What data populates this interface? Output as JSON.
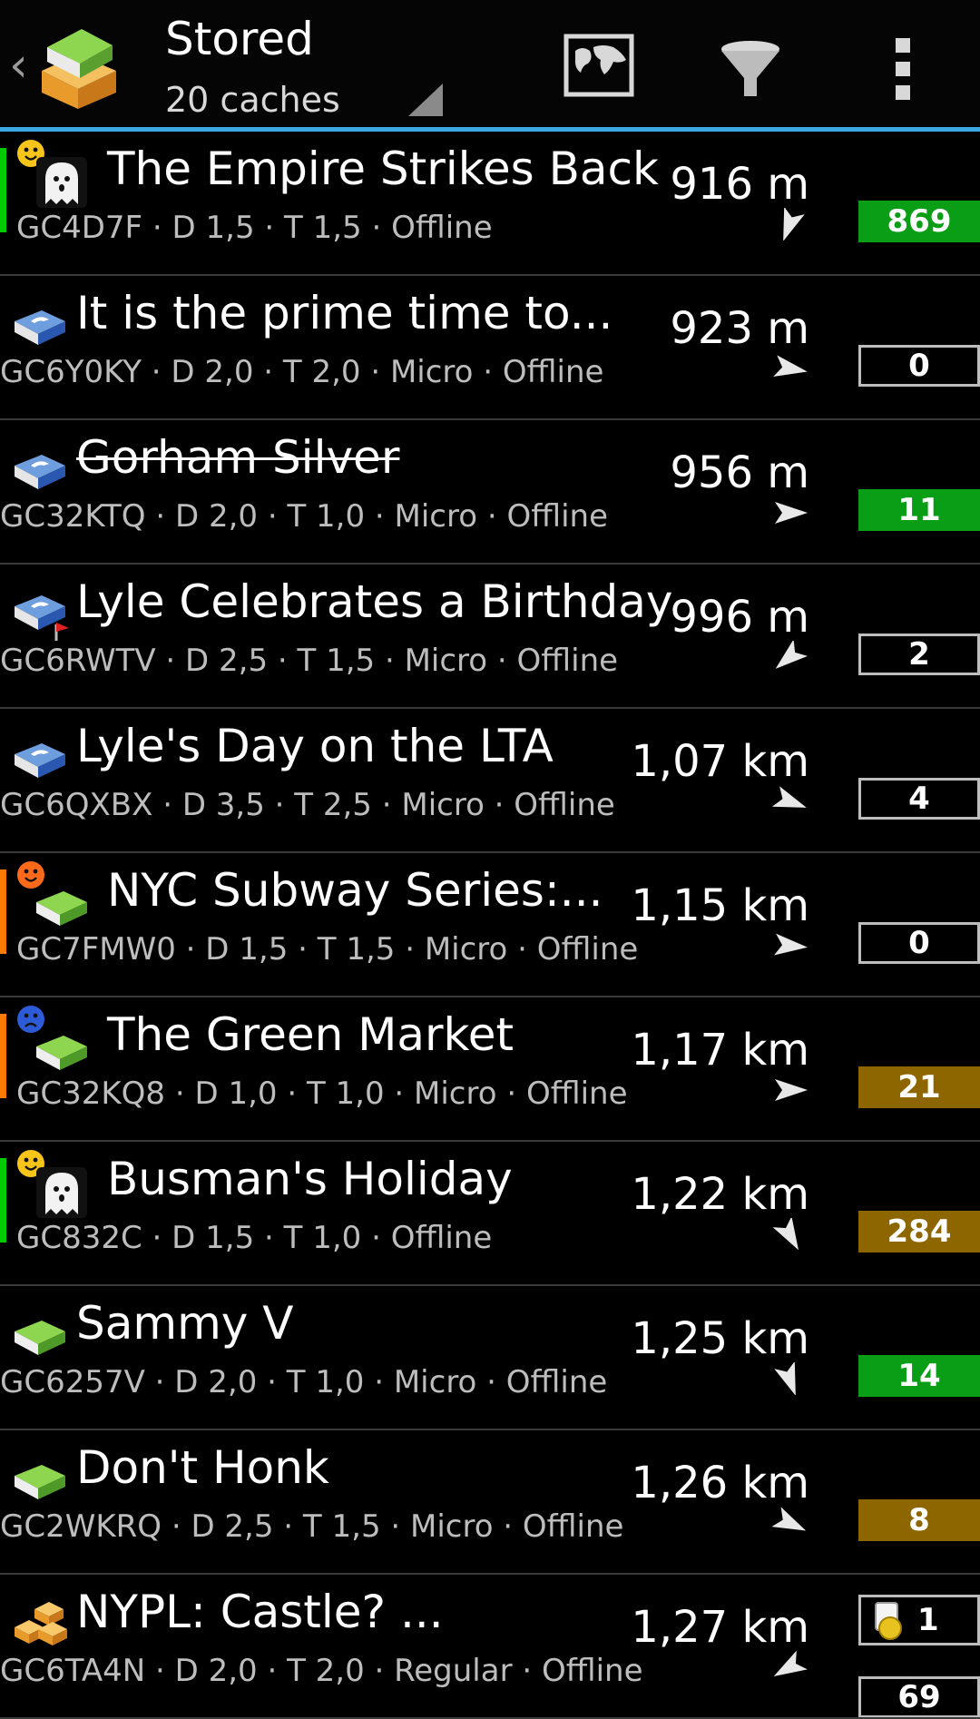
{
  "actionbar": {
    "title": "Stored",
    "subtitle": "20 caches",
    "back_icon": "chevron-left-icon",
    "app_icon": "cgeo-box-icon",
    "buttons": [
      {
        "name": "map-button",
        "icon": "world-map-icon"
      },
      {
        "name": "filter-button",
        "icon": "funnel-icon"
      },
      {
        "name": "overflow-menu-button",
        "icon": "more-vert-icon"
      }
    ],
    "accent": "#3aa7de"
  },
  "caches": [
    {
      "name": "The Empire Strikes Back",
      "info": "GC4D7F · D 1,5 · T 1,5 · Offline",
      "distance": "916 m",
      "count": "869",
      "count_style": "green",
      "type_icon": "ghost-icon",
      "face": "smiley-yellow",
      "stripe": "#00cc00",
      "struck": false,
      "bearing": 200
    },
    {
      "name": "It is the prime time to...",
      "info": "GC6Y0KY · D 2,0 · T 2,0 · Micro · Offline",
      "distance": "923 m",
      "count": "0",
      "count_style": "none",
      "type_icon": "mystery-box-icon",
      "face": "",
      "stripe": "",
      "struck": false,
      "bearing": 100
    },
    {
      "name": "Gorham Silver",
      "info": "GC32KTQ · D 2,0 · T 1,0 · Micro · Offline",
      "distance": "956 m",
      "count": "11",
      "count_style": "green",
      "type_icon": "mystery-box-icon",
      "face": "",
      "stripe": "",
      "struck": true,
      "bearing": 90
    },
    {
      "name": "Lyle Celebrates a Birthday",
      "info": "GC6RWTV · D 2,5 · T 1,5 · Micro · Offline",
      "distance": "996 m",
      "count": "2",
      "count_style": "none",
      "type_icon": "mystery-box-flag-icon",
      "face": "",
      "stripe": "",
      "struck": false,
      "bearing": 230
    },
    {
      "name": "Lyle's Day on the LTA",
      "info": "GC6QXBX · D 3,5 · T 2,5 · Micro · Offline",
      "distance": "1,07 km",
      "count": "4",
      "count_style": "none",
      "type_icon": "mystery-box-icon",
      "face": "",
      "stripe": "",
      "struck": false,
      "bearing": 110
    },
    {
      "name": "NYC Subway Series:...",
      "info": "GC7FMW0 · D 1,5 · T 1,5 · Micro · Offline",
      "distance": "1,15 km",
      "count": "0",
      "count_style": "none",
      "type_icon": "traditional-box-icon",
      "face": "smiley-orange",
      "stripe": "#ff7a00",
      "struck": false,
      "bearing": 95
    },
    {
      "name": "The Green Market",
      "info": "GC32KQ8 · D 1,0 · T 1,0 · Micro · Offline",
      "distance": "1,17 km",
      "count": "21",
      "count_style": "gold",
      "type_icon": "traditional-box-icon",
      "face": "smiley-blue",
      "stripe": "#ff7a00",
      "struck": false,
      "bearing": 90
    },
    {
      "name": "Busman's Holiday",
      "info": "GC832C · D 1,5 · T 1,0 · Offline",
      "distance": "1,22 km",
      "count": "284",
      "count_style": "gold",
      "type_icon": "ghost-icon",
      "face": "smiley-yellow",
      "stripe": "#00cc00",
      "struck": false,
      "bearing": 150
    },
    {
      "name": "Sammy V",
      "info": "GC6257V · D 2,0 · T 1,0 · Micro · Offline",
      "distance": "1,25 km",
      "count": "14",
      "count_style": "green",
      "type_icon": "traditional-box-icon",
      "face": "",
      "stripe": "",
      "struck": false,
      "bearing": 160
    },
    {
      "name": "Don't Honk",
      "info": "GC2WKRQ · D 2,5 · T 1,5 · Micro · Offline",
      "distance": "1,26 km",
      "count": "8",
      "count_style": "gold",
      "type_icon": "traditional-box-icon",
      "face": "",
      "stripe": "",
      "struck": false,
      "bearing": 115
    },
    {
      "name": "NYPL: Castle? ...",
      "info": "GC6TA4N · D 2,0 · T 2,0 · Regular · Offline",
      "distance": "1,27 km",
      "count": "69",
      "count_style": "none",
      "coin_count": "1",
      "coin_icon": "trackable-coin-icon",
      "type_icon": "multi-box-icon",
      "face": "",
      "stripe": "",
      "struck": false,
      "bearing": 240
    }
  ]
}
